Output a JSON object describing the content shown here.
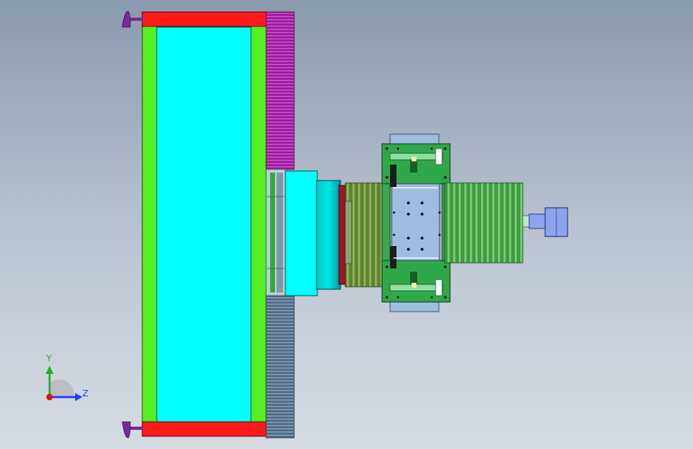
{
  "view": {
    "background_top": "#8a9aae",
    "background_bottom": "#d6dce2"
  },
  "model_colors": {
    "frame_red": "#ff1a1a",
    "frame_green": "#55ee22",
    "panel_cyan": "#00ffff",
    "upper_rack_magenta": "#aa22aa",
    "lower_rack_blue": "#5c7892",
    "bellows_green": "#6b8e3a",
    "carriage_green": "#2fa84a",
    "table_blue": "#9fbde0",
    "motor_blue": "#8ca3ee",
    "foot_purple": "#7a2a9a"
  },
  "triad": {
    "y_label": "Y",
    "z_label": "Z",
    "y_color": "#20b020",
    "z_color": "#1f3cff",
    "origin_color": "#e01010"
  }
}
